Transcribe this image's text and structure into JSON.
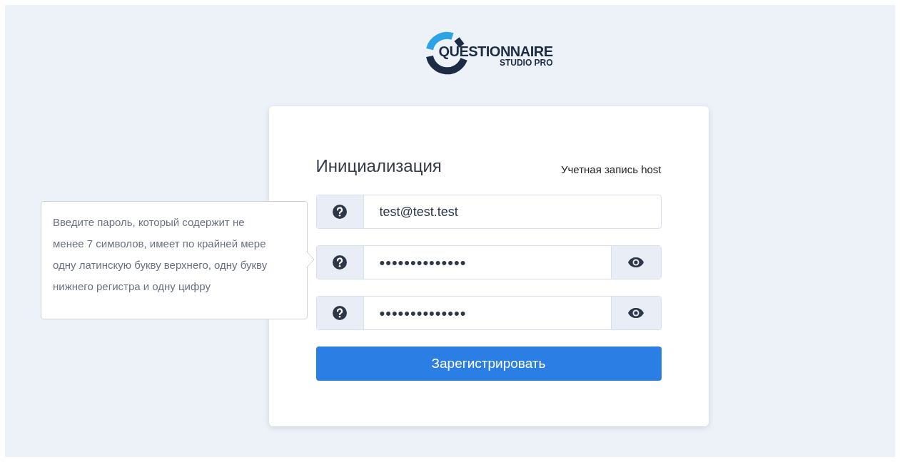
{
  "logo": {
    "line_1": "QUESTIONNAIRE",
    "line_2": "STUDIO PRO"
  },
  "form": {
    "title": "Инициализация",
    "account": "Учетная запись host",
    "fields": [
      {
        "kind": "text",
        "value": "test@test.test"
      },
      {
        "kind": "password",
        "value": "••••••••••••••"
      },
      {
        "kind": "password",
        "value": "••••••••••••••"
      }
    ],
    "submit": "Зарегистрировать"
  },
  "tooltip": {
    "text": "Введите пароль, который содержит не менее 7 символов, имеет по крайней мере одну латинскую букву верхнего, одну букву нижнего регистра и одну цифру"
  }
}
